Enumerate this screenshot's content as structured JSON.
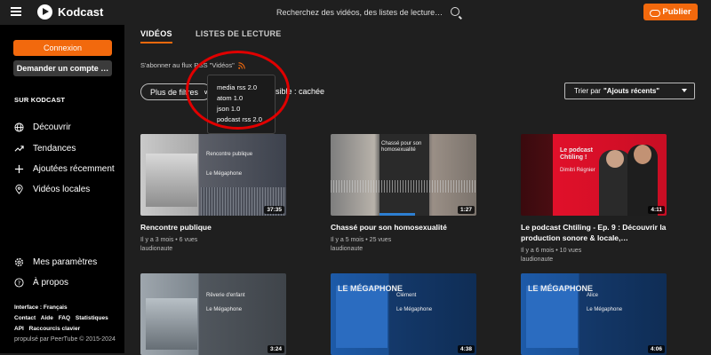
{
  "header": {
    "app_name": "Kodcast",
    "search_placeholder": "Recherchez des vidéos, des listes de lecture, des chaî…",
    "publish_label": "Publier",
    "accent_color": "#f2690d"
  },
  "sidebar": {
    "login_label": "Connexion",
    "request_account_label": "Demander un compte …",
    "section_title": "SUR KODCAST",
    "items": [
      {
        "label": "Découvrir",
        "icon": "globe-icon"
      },
      {
        "label": "Tendances",
        "icon": "trending-icon"
      },
      {
        "label": "Ajoutées récemment",
        "icon": "plus-icon"
      },
      {
        "label": "Vidéos locales",
        "icon": "location-icon"
      }
    ],
    "bottom_items": [
      {
        "label": "Mes paramètres",
        "icon": "gear-icon"
      },
      {
        "label": "À propos",
        "icon": "help-icon"
      }
    ],
    "footer_line1": "Interface : Français",
    "footer_links": [
      "Contact",
      "Aide",
      "FAQ",
      "Statistiques"
    ],
    "footer_links2": [
      "API",
      "Raccourcis clavier"
    ],
    "powered_by": "propulsé par PeerTube © 2015-2024"
  },
  "main": {
    "tabs": [
      "VIDÉOS",
      "LISTES DE LECTURE"
    ],
    "rss_text": "S'abonner au flux RSS \"Vidéos\"",
    "rss_prefix": "S'abonner au flux ",
    "rss_suffix": "SS \"Vidéos\"",
    "filter_label": "Plus de filtres",
    "sensitive_label": "sible : cachée",
    "sort_prefix": "Trier par",
    "sort_value": "\"Ajouts récents\"",
    "rss_dropdown": [
      "media rss 2.0",
      "atom 1.0",
      "json 1.0",
      "podcast rss 2.0"
    ]
  },
  "videos": [
    {
      "title": "Rencontre publique",
      "meta1": "Il y a 3 mois • 6 vues",
      "meta2": "laudionaute",
      "duration": "37:35",
      "thumb_title": "Rencontre publique",
      "thumb_sub": "Le Mégaphone"
    },
    {
      "title": "Chassé pour son homosexualité",
      "meta1": "Il y a 5 mois • 25 vues",
      "meta2": "laudionaute",
      "duration": "1:27",
      "thumb_title": "Chassé pour son homosexualité",
      "thumb_sub": ""
    },
    {
      "title": "Le podcast Chtiling - Ep. 9 : Découvrir la production sonore & locale,…",
      "meta1": "Il y a 6 mois • 10 vues",
      "meta2": "laudionaute",
      "duration": "4:11",
      "thumb_title": "Le podcast Chtiling !",
      "thumb_sub": "Dimitri Régnier"
    },
    {
      "title": "",
      "meta1": "",
      "meta2": "",
      "duration": "3:24",
      "thumb_title": "Rêverie d'enfant",
      "thumb_sub": "Le Mégaphone"
    },
    {
      "title": "",
      "meta1": "",
      "meta2": "",
      "duration": "4:38",
      "thumb_title": "Clément",
      "thumb_sub": "Le Mégaphone"
    },
    {
      "title": "",
      "meta1": "",
      "meta2": "",
      "duration": "4:06",
      "thumb_title": "Alice",
      "thumb_sub": "Le Mégaphone"
    }
  ]
}
